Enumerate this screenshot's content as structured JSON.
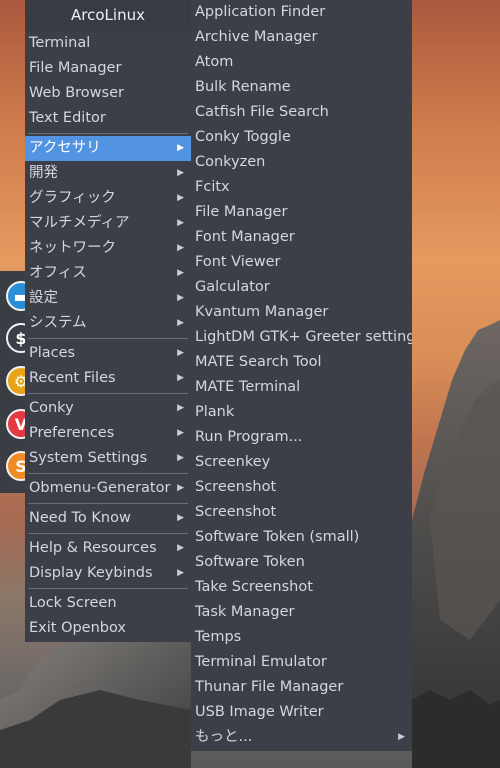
{
  "colors": {
    "menu_bg": "#3c3f47",
    "highlight": "#5294e2",
    "text": "#d3d7de",
    "dock_bg": "#3a3d44"
  },
  "dock": {
    "icons": [
      {
        "name": "file-manager-icon",
        "glyph": "▬",
        "color": "#2a8fd6"
      },
      {
        "name": "terminal-icon",
        "glyph": "$",
        "color": "#3b3e44"
      },
      {
        "name": "settings-icon",
        "glyph": "⚙",
        "color": "#e8a317"
      },
      {
        "name": "vivaldi-icon",
        "glyph": "V",
        "color": "#e63946"
      },
      {
        "name": "software-icon",
        "glyph": "S",
        "color": "#f08a24"
      }
    ]
  },
  "main_menu": {
    "title": "ArcoLinux",
    "items": [
      {
        "label": "Terminal",
        "submenu": false
      },
      {
        "label": "File Manager",
        "submenu": false
      },
      {
        "label": "Web Browser",
        "submenu": false
      },
      {
        "label": "Text Editor",
        "submenu": false
      },
      {
        "label": "アクセサリ",
        "submenu": true,
        "active": true
      },
      {
        "label": "開発",
        "submenu": true
      },
      {
        "label": "グラフィック",
        "submenu": true
      },
      {
        "label": "マルチメディア",
        "submenu": true
      },
      {
        "label": "ネットワーク",
        "submenu": true
      },
      {
        "label": "オフィス",
        "submenu": true
      },
      {
        "label": "設定",
        "submenu": true
      },
      {
        "label": "システム",
        "submenu": true
      },
      {
        "label": "Places",
        "submenu": true
      },
      {
        "label": "Recent Files",
        "submenu": true
      },
      {
        "label": "Conky",
        "submenu": true
      },
      {
        "label": "Preferences",
        "submenu": true
      },
      {
        "label": "System Settings",
        "submenu": true
      },
      {
        "label": "Obmenu-Generator",
        "submenu": true
      },
      {
        "label": "Need To Know",
        "submenu": true
      },
      {
        "label": "Help & Resources",
        "submenu": true
      },
      {
        "label": "Display Keybinds",
        "submenu": true
      },
      {
        "label": "Lock Screen",
        "submenu": false
      },
      {
        "label": "Exit Openbox",
        "submenu": false
      }
    ]
  },
  "sub_menu": {
    "items": [
      {
        "label": "Application Finder"
      },
      {
        "label": "Archive Manager"
      },
      {
        "label": "Atom"
      },
      {
        "label": "Bulk Rename"
      },
      {
        "label": "Catfish File Search"
      },
      {
        "label": "Conky Toggle"
      },
      {
        "label": "Conkyzen"
      },
      {
        "label": "Fcitx"
      },
      {
        "label": "File Manager"
      },
      {
        "label": "Font Manager"
      },
      {
        "label": "Font Viewer"
      },
      {
        "label": "Galculator"
      },
      {
        "label": "Kvantum Manager"
      },
      {
        "label": "LightDM GTK+ Greeter settings"
      },
      {
        "label": "MATE Search Tool"
      },
      {
        "label": "MATE Terminal"
      },
      {
        "label": "Plank"
      },
      {
        "label": "Run Program..."
      },
      {
        "label": "Screenkey"
      },
      {
        "label": "Screenshot"
      },
      {
        "label": "Screenshot"
      },
      {
        "label": "Software Token (small)"
      },
      {
        "label": "Software Token"
      },
      {
        "label": "Take Screenshot"
      },
      {
        "label": "Task Manager"
      },
      {
        "label": "Temps"
      },
      {
        "label": "Terminal Emulator"
      },
      {
        "label": "Thunar File Manager"
      },
      {
        "label": "USB Image Writer"
      },
      {
        "label": "もっと...",
        "submenu": true
      }
    ]
  }
}
